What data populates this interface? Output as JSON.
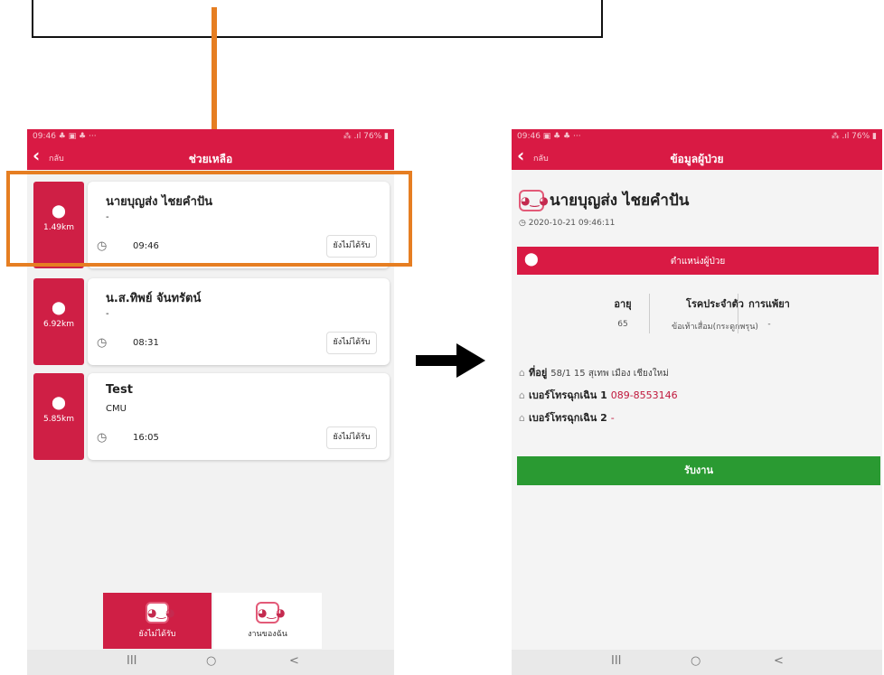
{
  "colors": {
    "brand": "#d91a44",
    "accent": "#e67e22",
    "success": "#2a9a32"
  },
  "left": {
    "status": {
      "time": "09:46 ♣ ▣ ♣ ···",
      "right": "⁂ .ıl 76% ▮"
    },
    "appbar": {
      "back_label": "กลับ",
      "title": "ช่วยเหลือ"
    },
    "cards": [
      {
        "distance": "1.49km",
        "name": "นายบุญส่ง ไชยคำปัน",
        "sub": "-",
        "time": "09:46",
        "button": "ยังไม่ได้รับ"
      },
      {
        "distance": "6.92km",
        "name": "น.ส.ทิพย์ จันทรัตน์",
        "sub": "-",
        "time": "08:31",
        "button": "ยังไม่ได้รับ"
      },
      {
        "distance": "5.85km",
        "name": "Test",
        "sub": "CMU",
        "time": "16:05",
        "button": "ยังไม่ได้รับ"
      }
    ],
    "tabs": [
      {
        "label": "ยังไม่ได้รับ"
      },
      {
        "label": "งานของฉัน"
      }
    ],
    "nav": {
      "recent": "III",
      "home": "○",
      "back": "<"
    }
  },
  "right": {
    "status": {
      "time": "09:46 ▣ ♣ ♣ ···",
      "right": "⁂ .ıl 76% ▮"
    },
    "appbar": {
      "back_label": "กลับ",
      "title": "ข้อมูลผู้ป่วย"
    },
    "patient_name": "นายบุญส่ง ไชยคำปัน",
    "timestamp": "2020-10-21 09:46:11",
    "location_label": "ตำแหน่งผู้ป่วย",
    "info": {
      "age_label": "อายุ",
      "age": "65",
      "disease_label": "โรคประจำตัว",
      "disease": "ข้อเท้าเสื่อม(กระดูกพรุน)",
      "allergy_label": "การแพ้ยา",
      "allergy": "-"
    },
    "address_label": "ที่อยู่",
    "address": "58/1 15 สุเทพ เมือง เชียงใหม่",
    "phone1_label": "เบอร์โทรฉุกเฉิน 1",
    "phone1": "089-8553146",
    "phone2_label": "เบอร์โทรฉุกเฉิน 2",
    "phone2": "-",
    "accept_button": "รับงาน",
    "nav": {
      "recent": "III",
      "home": "○",
      "back": "<"
    }
  }
}
